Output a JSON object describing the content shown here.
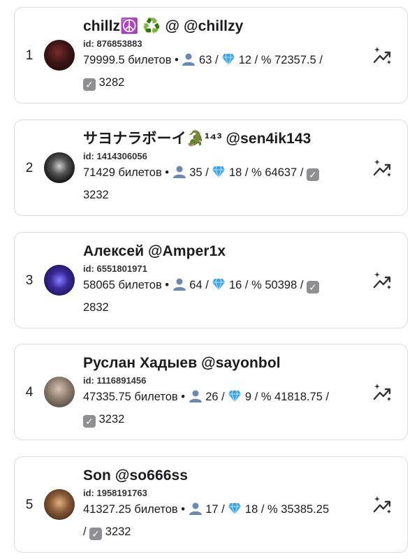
{
  "entries": [
    {
      "rank": "1",
      "name": "chillz☮️ ♻️ @ @chillzy",
      "id_text": "id: 876853883",
      "tickets": "79999.5 билетов",
      "users": "63",
      "gems": "12",
      "percent": "% 72357.5",
      "checks": "3282"
    },
    {
      "rank": "2",
      "name": "サヨナラボーイ🐊¹⁴³ @sen4ik143",
      "id_text": "id: 1414306056",
      "tickets": "71429 билетов",
      "users": "35",
      "gems": "18",
      "percent": "% 64637",
      "checks": "3232"
    },
    {
      "rank": "3",
      "name": "Алексей @Amper1x",
      "id_text": "id: 6551801971",
      "tickets": "58065 билетов",
      "users": "64",
      "gems": "16",
      "percent": "% 50398",
      "checks": "2832"
    },
    {
      "rank": "4",
      "name": "Руслан Хадыев @sayonbol",
      "id_text": "id: 1116891456",
      "tickets": "47335.75 билетов",
      "users": "26",
      "gems": "9",
      "percent": "% 41818.75",
      "checks": "3232"
    },
    {
      "rank": "5",
      "name": "Son @so666ss",
      "id_text": "id: 1958191763",
      "tickets": "41327.25 билетов",
      "users": "17",
      "gems": "18",
      "percent": "% 35385.25",
      "checks": "3232"
    }
  ],
  "icons": {
    "user": "user-icon",
    "gem": "gem-icon",
    "check": "checkbox-icon",
    "trend": "trending-sparkle-icon"
  },
  "colors": {
    "border": "#dcdcdf",
    "text": "#1c1c1e",
    "user_icon": "#6a88b0",
    "gem_icon": "#3aa4e8",
    "check_bg": "#8e8e93"
  }
}
